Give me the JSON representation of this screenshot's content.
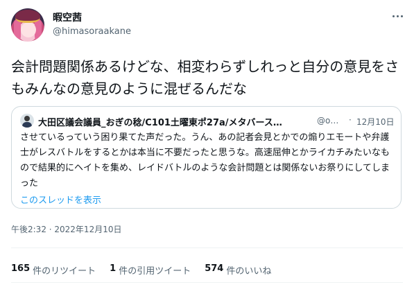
{
  "author": {
    "display_name": "暇空茜",
    "handle": "@himasoraakane"
  },
  "tweet": {
    "text": "会計問題関係あるけどな、相変わらずしれっと自分の意見をさもみんなの意見のように混ぜるんだな"
  },
  "quote": {
    "display_name": "大田区議会議員_おぎの稔/C101土曜東ポ27a/メタバース…",
    "handle": "@o…",
    "separator": "·",
    "date": "12月10日",
    "text": "させているっていう困り果てた声だった。うん、あの記者会見とかでの煽りエモートや弁護士がレスバトルをするとかは本当に不要だったと思うな。高速屈伸とかライカチみたいなもので結果的にヘイトを集め、レイドバトルのような会計問題とは関係ないお祭りにしてしまった",
    "show_thread": "このスレッドを表示"
  },
  "timestamp": "午後2:32 · 2022年12月10日",
  "stats": {
    "retweets_count": "165",
    "retweets_label": "件のリツイート",
    "quotes_count": "1",
    "quotes_label": "件の引用ツイート",
    "likes_count": "574",
    "likes_label": "件のいいね"
  },
  "icons": {
    "more": "more-horizontal-icon"
  },
  "colors": {
    "accent": "#1d9bf0",
    "secondary_text": "#536471",
    "border": "#cfd9de"
  }
}
